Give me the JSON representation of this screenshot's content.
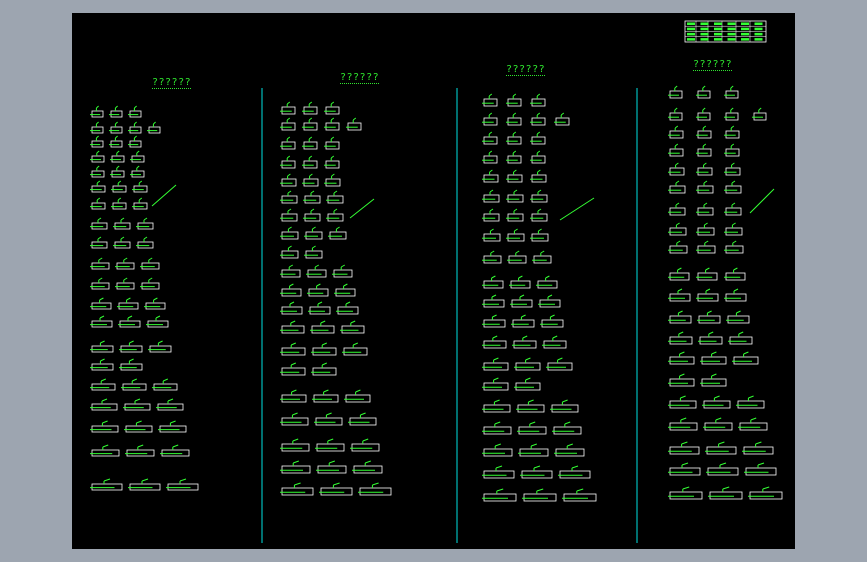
{
  "columns": [
    {
      "title": "??????"
    },
    {
      "title": "??????"
    },
    {
      "title": "??????"
    },
    {
      "title": "??????"
    }
  ],
  "colors": {
    "frame_bg": "#9da5b0",
    "sheet_bg": "#000000",
    "element_green": "#33ff33",
    "section_white": "#ffffff",
    "divider_cyan": "#00e0e0"
  }
}
